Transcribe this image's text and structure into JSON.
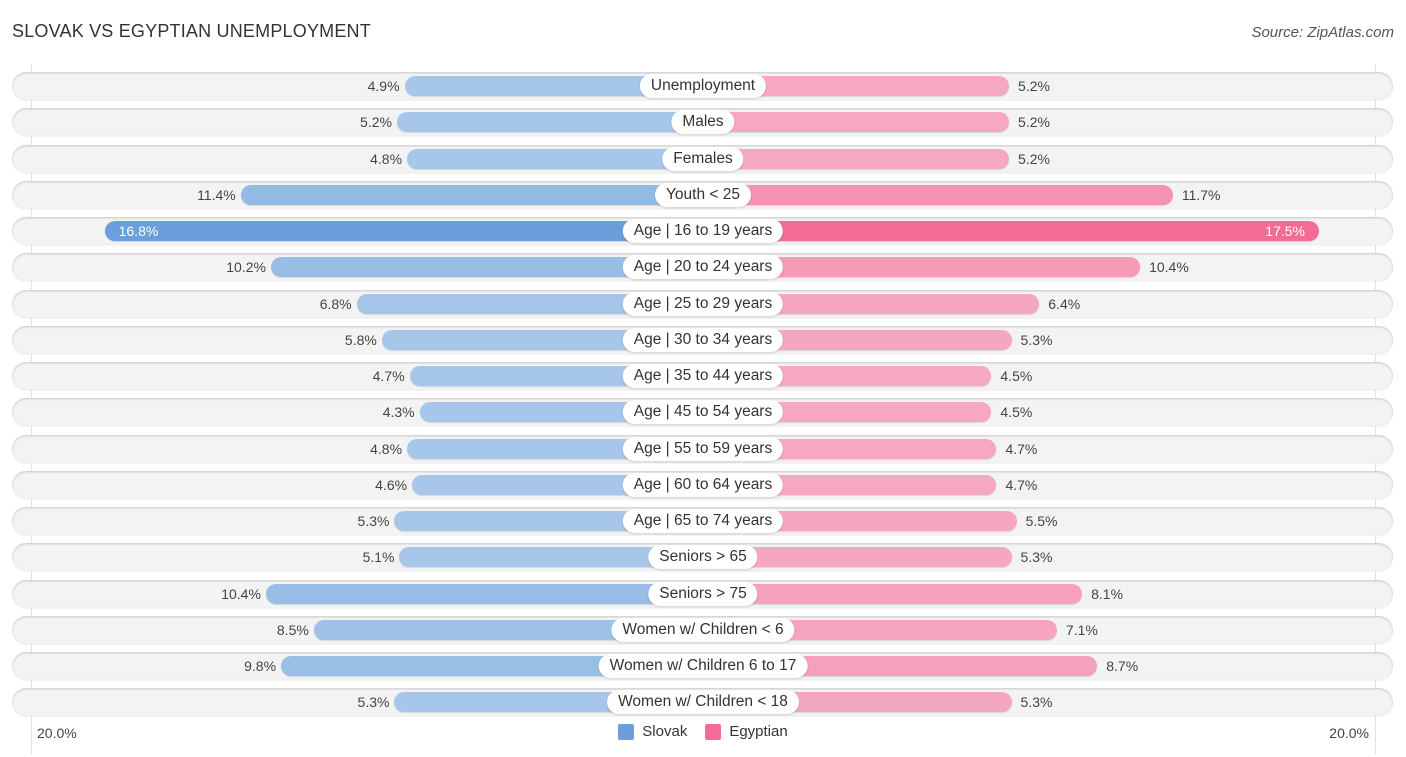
{
  "header": {
    "title": "SLOVAK VS EGYPTIAN UNEMPLOYMENT",
    "source": "Source: ZipAtlas.com"
  },
  "colors": {
    "slovak_light": "#a7c7ea",
    "slovak_strong": "#6a9fdb",
    "egyptian_light": "#f6a8c0",
    "egyptian_strong": "#f26c95"
  },
  "legend": [
    {
      "label": "Slovak",
      "color": "#6a9fdb"
    },
    {
      "label": "Egyptian",
      "color": "#f26c95"
    }
  ],
  "axis": {
    "left_label": "20.0%",
    "right_label": "20.0%"
  },
  "chart_data": {
    "type": "bar",
    "orientation": "horizontal-diverging",
    "title": "SLOVAK VS EGYPTIAN UNEMPLOYMENT",
    "xlabel": "",
    "ylabel": "",
    "xlim": [
      0,
      20
    ],
    "axis_tick_labels": [
      "20.0%",
      "20.0%"
    ],
    "legend_position": "bottom-center",
    "categories": [
      "Unemployment",
      "Males",
      "Females",
      "Youth < 25",
      "Age | 16 to 19 years",
      "Age | 20 to 24 years",
      "Age | 25 to 29 years",
      "Age | 30 to 34 years",
      "Age | 35 to 44 years",
      "Age | 45 to 54 years",
      "Age | 55 to 59 years",
      "Age | 60 to 64 years",
      "Age | 65 to 74 years",
      "Seniors > 65",
      "Seniors > 75",
      "Women w/ Children < 6",
      "Women w/ Children 6 to 17",
      "Women w/ Children < 18"
    ],
    "series": [
      {
        "name": "Slovak",
        "values": [
          4.9,
          5.2,
          4.8,
          11.4,
          16.8,
          10.2,
          6.8,
          5.8,
          4.7,
          4.3,
          4.8,
          4.6,
          5.3,
          5.1,
          10.4,
          8.5,
          9.8,
          5.3
        ]
      },
      {
        "name": "Egyptian",
        "values": [
          5.2,
          5.2,
          5.2,
          11.7,
          17.5,
          10.4,
          6.4,
          5.3,
          4.5,
          4.5,
          4.7,
          4.7,
          5.5,
          5.3,
          8.1,
          7.1,
          8.7,
          5.3
        ]
      }
    ],
    "value_labels": {
      "Slovak": [
        "4.9%",
        "5.2%",
        "4.8%",
        "11.4%",
        "16.8%",
        "10.2%",
        "6.8%",
        "5.8%",
        "4.7%",
        "4.3%",
        "4.8%",
        "4.6%",
        "5.3%",
        "5.1%",
        "10.4%",
        "8.5%",
        "9.8%",
        "5.3%"
      ],
      "Egyptian": [
        "5.2%",
        "5.2%",
        "5.2%",
        "11.7%",
        "17.5%",
        "10.4%",
        "6.4%",
        "5.3%",
        "4.5%",
        "4.5%",
        "4.7%",
        "4.7%",
        "5.5%",
        "5.3%",
        "8.1%",
        "7.1%",
        "8.7%",
        "5.3%"
      ]
    }
  }
}
